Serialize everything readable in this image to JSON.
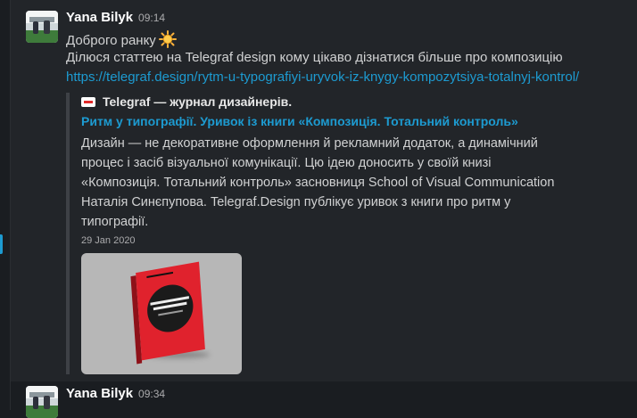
{
  "messages": [
    {
      "author": "Yana Bilyk",
      "time": "09:14",
      "lines": [
        "Доброго ранку",
        "Ділюся статтею на Telegraf design кому цікаво дізнатися більше про композицію"
      ],
      "emoji": "sun-icon",
      "link": "https://telegraf.design/rytm-u-typografiyi-uryvok-iz-knygy-kompozytsiya-totalnyj-kontrol/",
      "attachment": {
        "site": "Telegraf — журнал дизайнерів.",
        "headline": "Ритм у типографії. Уривок із книги «Композиція. Тотальний контроль»",
        "text": "Дизайн — не декоративне оформлення й рекламний додаток, а динамічний процес і засіб візуальної комунікації. Цю ідею доносить у своїй книзі «Композиція. Тотальний контроль» засновниця School of Visual Communication Наталія Синєпупова. Telegraf.Design публікує уривок з книги про ритм у типографії.",
        "date": "29 Jan 2020"
      }
    },
    {
      "author": "Yana Bilyk",
      "time": "09:34"
    }
  ],
  "colors": {
    "background": "#1a1d21",
    "hover_background": "#222529",
    "link": "#1d9bd1",
    "attachment_bar": "#3e4146",
    "book_red": "#e0222d"
  }
}
